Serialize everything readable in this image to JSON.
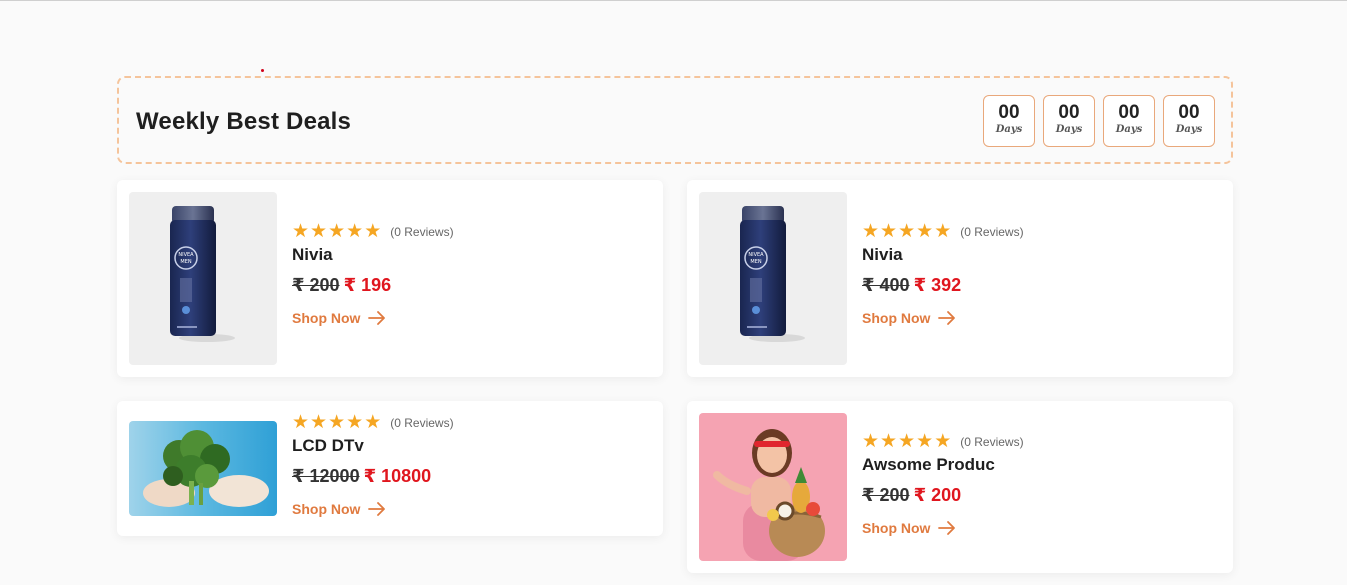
{
  "section": {
    "title": "Weekly Best Deals",
    "countdown": [
      {
        "value": "00",
        "label": "Days"
      },
      {
        "value": "00",
        "label": "Days"
      },
      {
        "value": "00",
        "label": "Days"
      },
      {
        "value": "00",
        "label": "Days"
      }
    ]
  },
  "colors": {
    "accent": "#e07a3f",
    "star": "#f5a623",
    "sale_price": "#e0161e",
    "dashed_border": "#f5c49b"
  },
  "products": [
    {
      "rating": 5,
      "reviews": "(0 Reviews)",
      "name": "Nivia",
      "old_price": "₹ 200",
      "new_price": "₹ 196",
      "cta": "Shop Now",
      "image": "nivea-men-bottle"
    },
    {
      "rating": 5,
      "reviews": "(0 Reviews)",
      "name": "Nivia",
      "old_price": "₹ 400",
      "new_price": "₹ 392",
      "cta": "Shop Now",
      "image": "nivea-men-bottle"
    },
    {
      "rating": 5,
      "reviews": "(0 Reviews)",
      "name": "LCD DTv",
      "old_price": "₹ 12000",
      "new_price": "₹ 10800",
      "cta": "Shop Now",
      "image": "hands-holding-greens"
    },
    {
      "rating": 5,
      "reviews": "(0 Reviews)",
      "name": "Awsome Produc",
      "old_price": "₹ 200",
      "new_price": "₹ 200",
      "cta": "Shop Now",
      "image": "woman-with-fruit-basket"
    }
  ]
}
